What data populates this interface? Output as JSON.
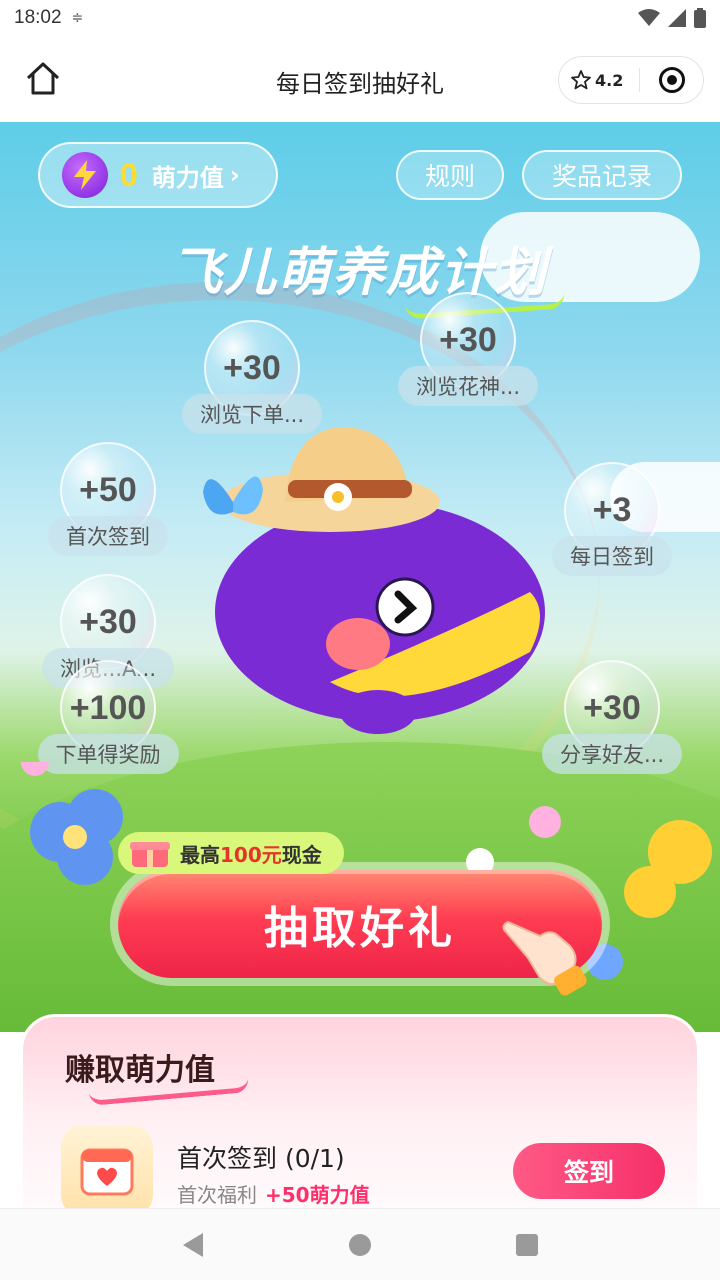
{
  "status_bar": {
    "time": "18:02",
    "extra": "≑"
  },
  "nav": {
    "title": "每日签到抽好礼",
    "rating": "4.2"
  },
  "hero": {
    "meng_count": "0",
    "meng_label": "萌力值",
    "meng_arrow": "›",
    "rules_label": "规则",
    "records_label": "奖品记录",
    "title": "飞儿萌养成计划",
    "bubbles": [
      {
        "points": "+30",
        "label": "浏览下单..."
      },
      {
        "points": "+30",
        "label": "浏览花神..."
      },
      {
        "points": "+50",
        "label": "首次签到"
      },
      {
        "points": "+3",
        "label": "每日签到"
      },
      {
        "points": "+30",
        "label": "浏览...A..."
      },
      {
        "points": "+100",
        "label": "下单得奖励"
      },
      {
        "points": "+30",
        "label": "分享好友..."
      }
    ],
    "draw_tag_prefix": "最高",
    "draw_tag_highlight": "100元",
    "draw_tag_suffix": "现金",
    "draw_button": "抽取好礼"
  },
  "earn": {
    "title": "赚取萌力值",
    "task": {
      "title": "首次签到 (0/1)",
      "desc": "首次福利",
      "reward": "+50萌力值",
      "button": "签到"
    }
  }
}
